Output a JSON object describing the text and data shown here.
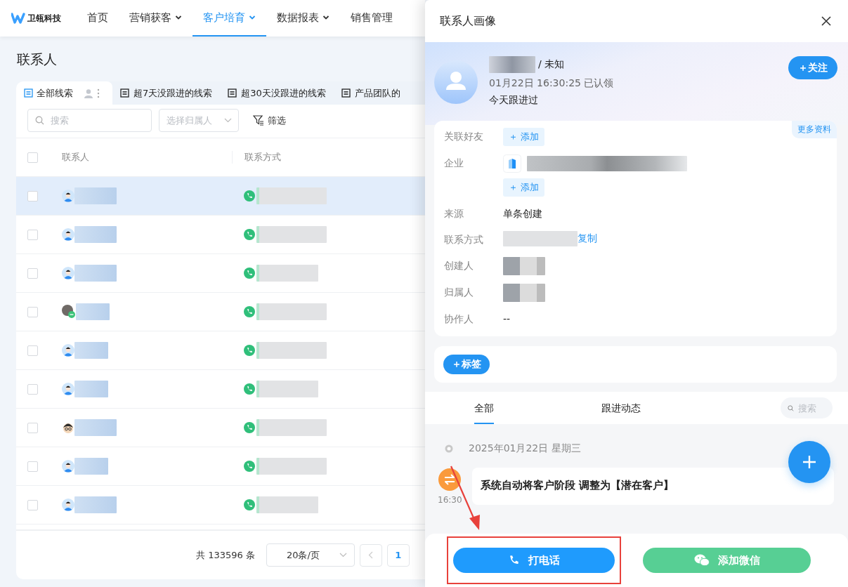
{
  "nav": {
    "logo": "卫瓴科技",
    "items": [
      {
        "label": "首页",
        "dropdown": false,
        "selected": false
      },
      {
        "label": "营销获客",
        "dropdown": true,
        "selected": false
      },
      {
        "label": "客户培育",
        "dropdown": true,
        "selected": true
      },
      {
        "label": "数据报表",
        "dropdown": true,
        "selected": false
      },
      {
        "label": "销售管理",
        "dropdown": false,
        "selected": false
      }
    ]
  },
  "page": {
    "title": "联系人"
  },
  "views": [
    {
      "label": "全部线索",
      "selected": true
    },
    {
      "label": "超7天没跟进的线索",
      "selected": false
    },
    {
      "label": "超30天没跟进的线索",
      "selected": false
    },
    {
      "label": "产品团队的",
      "selected": false
    }
  ],
  "filters": {
    "search_placeholder": "搜索",
    "owner_placeholder": "选择归属人",
    "filter_label": "筛选"
  },
  "table": {
    "columns": [
      "联系人",
      "联系方式"
    ],
    "all_checked": false,
    "rows": [
      {
        "kind": "default",
        "highlighted": true,
        "checked": false
      },
      {
        "kind": "default",
        "highlighted": false,
        "checked": false
      },
      {
        "kind": "default",
        "highlighted": false,
        "checked": false
      },
      {
        "kind": "photo",
        "highlighted": false,
        "checked": false
      },
      {
        "kind": "default",
        "highlighted": false,
        "checked": false
      },
      {
        "kind": "default",
        "highlighted": false,
        "checked": false
      },
      {
        "kind": "cartoon",
        "highlighted": false,
        "checked": false
      },
      {
        "kind": "default",
        "highlighted": false,
        "checked": false
      },
      {
        "kind": "default",
        "highlighted": false,
        "checked": false
      }
    ]
  },
  "pagination": {
    "total": "共 133596 条",
    "page_size": "20条/页",
    "pages": [
      {
        "label": "1",
        "selected": true
      }
    ]
  },
  "drawer": {
    "title": "联系人画像",
    "profile": {
      "gender": "/ 未知",
      "claimed": "01月22日 16:30:25 已认领",
      "followed": "今天跟进过",
      "follow_button": "＋关注"
    },
    "more_link": "更多资料",
    "fields": [
      {
        "kind": "add",
        "label": "关联好友",
        "button": "＋ 添加"
      },
      {
        "kind": "company",
        "label": "企业",
        "button": "＋ 添加"
      },
      {
        "kind": "text",
        "label": "来源",
        "value": "单条创建"
      },
      {
        "kind": "contact",
        "label": "联系方式",
        "link": "复制"
      },
      {
        "kind": "person",
        "label": "创建人"
      },
      {
        "kind": "person",
        "label": "归属人"
      },
      {
        "kind": "text",
        "label": "协作人",
        "value": "--"
      }
    ],
    "tag_button": "＋标签",
    "tabs": [
      {
        "label": "全部",
        "selected": true
      },
      {
        "label": "跟进动态",
        "selected": false
      }
    ],
    "search_placeholder": "搜索",
    "timeline": {
      "date": "2025年01月22日 星期三",
      "events": [
        {
          "time": "16:30",
          "text": "系统自动将客户阶段 调整为【潜在客户】"
        }
      ]
    },
    "actions": [
      {
        "kind": "call",
        "label": "打电话",
        "highlighted": true
      },
      {
        "kind": "wechat",
        "label": "添加微信",
        "highlighted": false
      }
    ]
  }
}
